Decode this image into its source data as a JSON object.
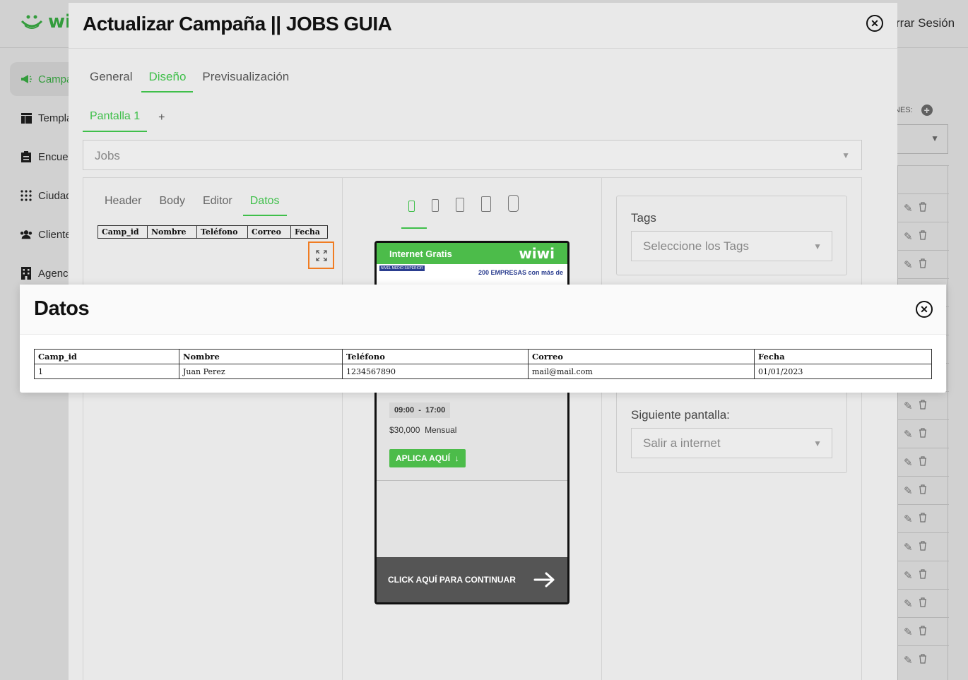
{
  "app": {
    "brand": "wi",
    "logout_label": "rrar Sesión"
  },
  "sidebar": {
    "items": [
      {
        "label": "Campa",
        "icon": "megaphone-icon",
        "active": true
      },
      {
        "label": "Templa",
        "icon": "template-icon",
        "active": false
      },
      {
        "label": "Encue",
        "icon": "clipboard-icon",
        "active": false
      },
      {
        "label": "Ciudad",
        "icon": "grid-dots-icon",
        "active": false
      },
      {
        "label": "Cliente",
        "icon": "users-icon",
        "active": false
      },
      {
        "label": "Agenc",
        "icon": "building-icon",
        "active": false
      }
    ]
  },
  "right_panel": {
    "label": "NES:",
    "add_symbol": "+"
  },
  "campaign_modal": {
    "title": "Actualizar Campaña || JOBS GUIA",
    "close_symbol": "✕",
    "tabs": [
      "General",
      "Diseño",
      "Previsualización"
    ],
    "active_tab": "Diseño",
    "screen_tab": "Pantalla 1",
    "screen_add": "+",
    "template_value": "Jobs",
    "subtabs": [
      "Header",
      "Body",
      "Editor",
      "Datos"
    ],
    "active_subtab": "Datos",
    "mini_table_headers": [
      "Camp_id",
      "Nombre",
      "Teléfono",
      "Correo",
      "Fecha"
    ],
    "phone": {
      "header_text": "Internet Gratis",
      "brand": "wiwi",
      "banner_tag": "NIVEL MEDIO SUPERIOR",
      "banner_text": "200 EMPRESAS con más de",
      "time_start": "09:00",
      "time_sep": "-",
      "time_end": "17:00",
      "salary": "$30,000",
      "salary_period": "Mensual",
      "apply_label": "APLICA AQUÍ",
      "footer_label": "CLICK AQUÍ PARA CONTINUAR"
    },
    "tags": {
      "label": "Tags",
      "placeholder": "Seleccione los Tags"
    },
    "next_screen": {
      "label": "Siguiente pantalla:",
      "value": "Salir a internet"
    }
  },
  "datos_modal": {
    "title": "Datos",
    "close_symbol": "✕",
    "columns": [
      "Camp_id",
      "Nombre",
      "Teléfono",
      "Correo",
      "Fecha"
    ],
    "rows": [
      [
        "1",
        "Juan Perez",
        "1234567890",
        "mail@mail.com",
        "01/01/2023"
      ]
    ]
  },
  "colors": {
    "accent": "#3fbf4a",
    "highlight_border": "#f07c22"
  }
}
